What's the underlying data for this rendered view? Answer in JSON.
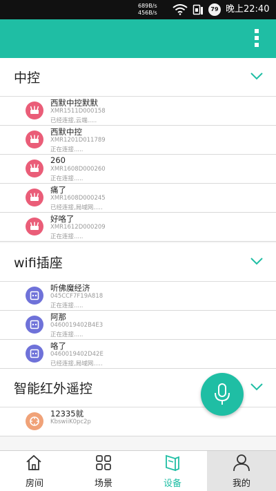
{
  "status_bar": {
    "speed_up": "689B/s",
    "speed_down": "456B/s",
    "battery": "79",
    "time": "晚上22:40"
  },
  "colors": {
    "accent": "#1fbea4",
    "hub_icon": "#ea5d78",
    "socket_icon": "#6f72d9",
    "ir_icon": "#f0a278"
  },
  "sections": [
    {
      "title": "中控",
      "icon": "router-icon",
      "devices": [
        {
          "name": "西默中控默默",
          "serial": "XMR1511D000158",
          "status": "已经连接,云端....."
        },
        {
          "name": "西默中控",
          "serial": "XMR1201D011789",
          "status": "正在连接....."
        },
        {
          "name": "260",
          "serial": "XMR1608D000260",
          "status": "正在连接....."
        },
        {
          "name": "痛了",
          "serial": "XMR1608D000245",
          "status": "已经连接,局域网....."
        },
        {
          "name": "好咯了",
          "serial": "XMR1612D000209",
          "status": "正在连接....."
        }
      ]
    },
    {
      "title": "wifi插座",
      "icon": "socket-icon",
      "devices": [
        {
          "name": "听佛魔经济",
          "serial": "045CCF7F19A818",
          "status": "正在连接....."
        },
        {
          "name": "阿那",
          "serial": "0460019402B4E3",
          "status": "正在连接....."
        },
        {
          "name": "咯了",
          "serial": "0460019402D42E",
          "status": "已经连接,局域网....."
        }
      ]
    },
    {
      "title": "智能红外遥控",
      "icon": "remote-icon",
      "devices": [
        {
          "name": "12335就",
          "serial": "KbswiiK0pc2p",
          "status": ""
        }
      ]
    }
  ],
  "bottom_nav": [
    {
      "label": "房间",
      "icon": "home-icon"
    },
    {
      "label": "场景",
      "icon": "scene-grid-icon"
    },
    {
      "label": "设备",
      "icon": "device-icon",
      "active": true
    },
    {
      "label": "我的",
      "icon": "user-icon"
    }
  ]
}
